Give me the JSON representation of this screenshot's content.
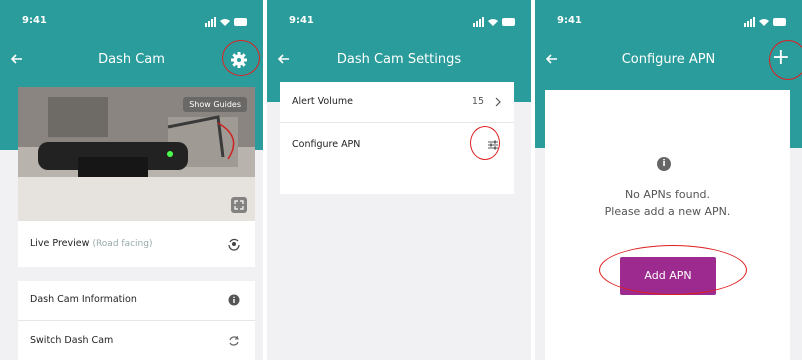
{
  "status": {
    "time": "9:41"
  },
  "screen1": {
    "title": "Dash Cam",
    "guides_label": "Show Guides",
    "live_preview_label": "Live Preview",
    "live_preview_sub": "(Road facing)",
    "info_label": "Dash Cam Information",
    "switch_label": "Switch Dash Cam"
  },
  "screen2": {
    "title": "Dash Cam Settings",
    "alert_volume_label": "Alert Volume",
    "alert_volume_value": "15",
    "configure_apn_label": "Configure APN"
  },
  "screen3": {
    "title": "Configure APN",
    "plus_label": "+",
    "empty_line1": "No APNs found.",
    "empty_line2": "Please add a new APN.",
    "add_button_label": "Add APN",
    "info_glyph": "i"
  },
  "colors": {
    "teal": "#2a9c9b",
    "purple": "#9c2a8f",
    "highlight": "#e02020"
  }
}
